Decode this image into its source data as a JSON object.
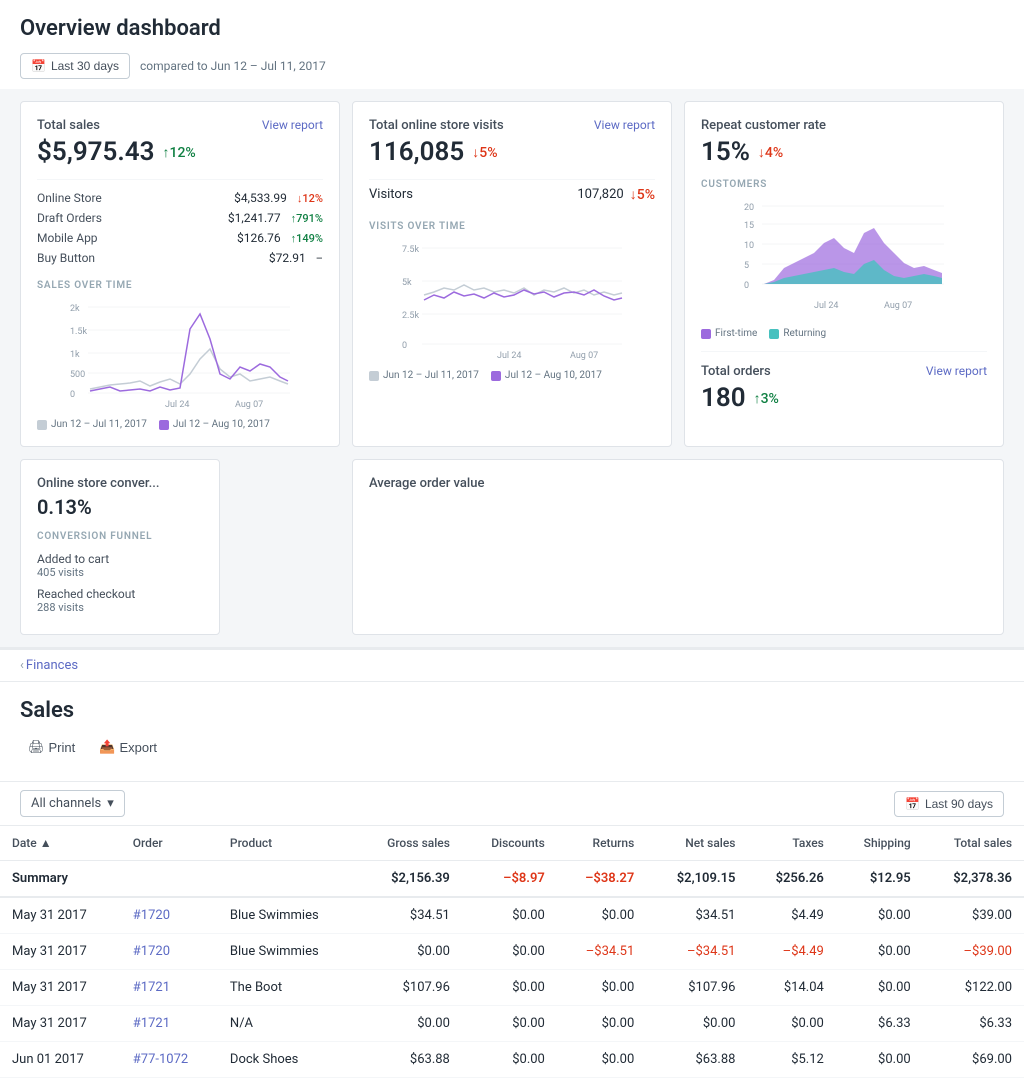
{
  "page": {
    "title": "Overview dashboard"
  },
  "dateFilter": {
    "label": "Last 30 days",
    "compareText": "compared to Jun 12 – Jul 11, 2017"
  },
  "totalSales": {
    "title": "Total sales",
    "viewReport": "View report",
    "value": "$5,975.43",
    "change": "12%",
    "changeDir": "up",
    "subRows": [
      {
        "label": "Online Store",
        "value": "$4,533.99",
        "change": "12%",
        "dir": "down"
      },
      {
        "label": "Draft Orders",
        "value": "$1,241.77",
        "change": "791%",
        "dir": "up"
      },
      {
        "label": "Mobile App",
        "value": "$126.76",
        "change": "149%",
        "dir": "up"
      },
      {
        "label": "Buy Button",
        "value": "$72.91",
        "change": "–",
        "dir": "none"
      }
    ],
    "chartLabel": "SALES OVER TIME",
    "legend": [
      {
        "label": "Jun 12 – Jul 11, 2017",
        "color": "#c4cdd5"
      },
      {
        "label": "Jul 12 – Aug 10, 2017",
        "color": "#9c6ade"
      }
    ]
  },
  "totalVisits": {
    "title": "Total online store visits",
    "viewReport": "View report",
    "value": "116,085",
    "change": "5%",
    "changeDir": "down",
    "visitorsLabel": "Visitors",
    "visitorsValue": "107,820",
    "visitorsChange": "5%",
    "visitorsDir": "down",
    "chartLabel": "VISITS OVER TIME",
    "yLabels": [
      "7.5k",
      "5k",
      "2.5k",
      "0"
    ],
    "xLabels": [
      "Jul 24",
      "Aug 07"
    ],
    "legend": [
      {
        "label": "Jun 12 – Jul 11, 2017",
        "color": "#c4cdd5"
      },
      {
        "label": "Jul 12 – Aug 10, 2017",
        "color": "#9c6ade"
      }
    ]
  },
  "repeatCustomer": {
    "title": "Repeat customer rate",
    "value": "15%",
    "change": "4%",
    "changeDir": "down",
    "chartLabel": "CUSTOMERS",
    "yLabels": [
      "20",
      "15",
      "10",
      "5",
      "0"
    ],
    "xLabels": [
      "Jul 24",
      "Aug 07"
    ],
    "legend": [
      {
        "label": "First-time",
        "color": "#9c6ade"
      },
      {
        "label": "Returning",
        "color": "#47c1bf"
      }
    ]
  },
  "totalOrders": {
    "title": "Total orders",
    "viewReport": "View report",
    "value": "180",
    "change": "3%",
    "changeDir": "up"
  },
  "onlineStoreConversion": {
    "title": "Online store conver...",
    "value": "0.13%",
    "chartLabel": "CONVERSION FUNNEL",
    "funnelRows": [
      {
        "label": "Added to cart",
        "visits": "405 visits"
      },
      {
        "label": "Reached checkout",
        "visits": "288 visits"
      }
    ]
  },
  "averageOrderValue": {
    "title": "Average order value"
  },
  "sales": {
    "breadcrumb": "Finances",
    "title": "Sales",
    "printLabel": "Print",
    "exportLabel": "Export",
    "channelFilter": "All channels",
    "periodLabel": "Last 90 days",
    "tableHeaders": [
      {
        "label": "Date",
        "sort": true
      },
      {
        "label": "Order",
        "sort": false
      },
      {
        "label": "Product",
        "sort": false
      },
      {
        "label": "Gross sales",
        "sort": false,
        "num": true
      },
      {
        "label": "Discounts",
        "sort": false,
        "num": true
      },
      {
        "label": "Returns",
        "sort": false,
        "num": true
      },
      {
        "label": "Net sales",
        "sort": false,
        "num": true
      },
      {
        "label": "Taxes",
        "sort": false,
        "num": true
      },
      {
        "label": "Shipping",
        "sort": false,
        "num": true
      },
      {
        "label": "Total sales",
        "sort": false,
        "num": true
      }
    ],
    "summary": {
      "label": "Summary",
      "grossSales": "$2,156.39",
      "discounts": "–$8.97",
      "returns": "–$38.27",
      "netSales": "$2,109.15",
      "taxes": "$256.26",
      "shipping": "$12.95",
      "totalSales": "$2,378.36"
    },
    "rows": [
      {
        "date": "May 31 2017",
        "order": "#1720",
        "product": "Blue Swimmies",
        "grossSales": "$34.51",
        "discounts": "$0.00",
        "returns": "$0.00",
        "netSales": "$34.51",
        "taxes": "$4.49",
        "shipping": "$0.00",
        "totalSales": "$39.00"
      },
      {
        "date": "May 31 2017",
        "order": "#1720",
        "product": "Blue Swimmies",
        "grossSales": "$0.00",
        "discounts": "$0.00",
        "returns": "–$34.51",
        "netSales": "–$34.51",
        "taxes": "–$4.49",
        "shipping": "$0.00",
        "totalSales": "–$39.00"
      },
      {
        "date": "May 31 2017",
        "order": "#1721",
        "product": "The Boot",
        "grossSales": "$107.96",
        "discounts": "$0.00",
        "returns": "$0.00",
        "netSales": "$107.96",
        "taxes": "$14.04",
        "shipping": "$0.00",
        "totalSales": "$122.00"
      },
      {
        "date": "May 31 2017",
        "order": "#1721",
        "product": "N/A",
        "grossSales": "$0.00",
        "discounts": "$0.00",
        "returns": "$0.00",
        "netSales": "$0.00",
        "taxes": "$0.00",
        "shipping": "$6.33",
        "totalSales": "$6.33"
      },
      {
        "date": "Jun 01 2017",
        "order": "#77-1072",
        "product": "Dock Shoes",
        "grossSales": "$63.88",
        "discounts": "$0.00",
        "returns": "$0.00",
        "netSales": "$63.88",
        "taxes": "$5.12",
        "shipping": "$0.00",
        "totalSales": "$69.00"
      }
    ]
  }
}
